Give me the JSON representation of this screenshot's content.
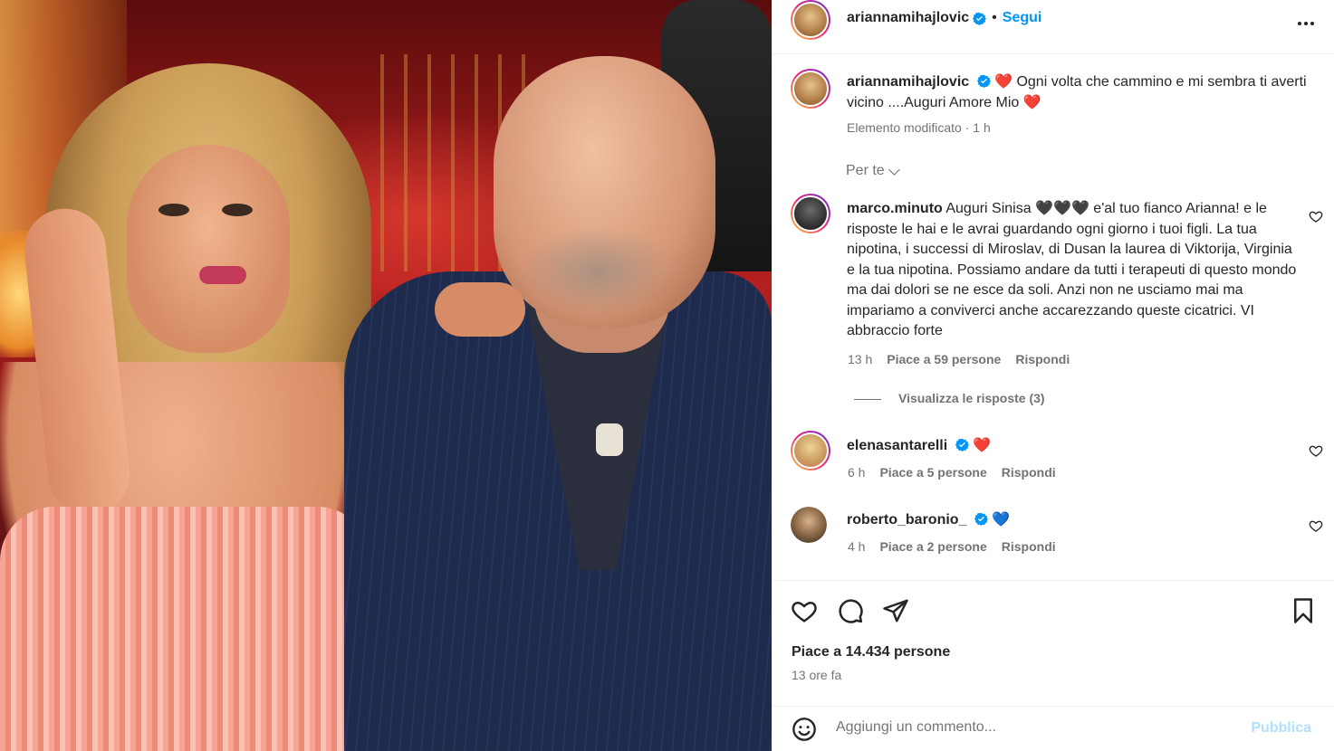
{
  "post": {
    "username": "ariannamihajlovic",
    "follow_label": "Segui",
    "dot": "•",
    "caption_text": "Ogni volta che cammino e mi sembra ti averti vicino ....Auguri Amore Mio",
    "caption_heart_start": "❤️",
    "caption_heart_end": "❤️",
    "caption_meta": "Elemento modificato · 1 h"
  },
  "filter": {
    "label": "Per te"
  },
  "comments": [
    {
      "username": "marco.minuto",
      "text_prefix": "Auguri Sinisa",
      "text_hearts": "🖤🖤🖤",
      "text_rest": " e'al tuo fianco Arianna! e le risposte le hai e le avrai guardando ogni giorno i tuoi figli. La tua nipotina, i successi di Miroslav, di Dusan la laurea di Viktorija, Virginia e la tua nipotina. Possiamo andare da tutti i terapeuti di questo mondo ma dai dolori se ne esce da soli. Anzi non ne usciamo mai ma impariamo a conviverci anche accarezzando queste cicatrici. VI abbraccio forte",
      "time": "13 h",
      "likes": "Piace a 59 persone",
      "reply": "Rispondi",
      "view_replies": "Visualizza le risposte (3)"
    },
    {
      "username": "elenasantarelli",
      "text": "❤️",
      "time": "6 h",
      "likes": "Piace a 5 persone",
      "reply": "Rispondi"
    },
    {
      "username": "roberto_baronio_",
      "text": "💙",
      "time": "4 h",
      "likes": "Piace a 2 persone",
      "reply": "Rispondi"
    }
  ],
  "actions": {
    "likes_count": "Piace a 14.434 persone",
    "posted": "13 ore fa"
  },
  "composer": {
    "placeholder": "Aggiungi un commento...",
    "post_label": "Pubblica"
  },
  "icons": {
    "verified": "verified-badge-icon",
    "more": "more-options-icon",
    "like": "heart-outline-icon",
    "comment": "comment-icon",
    "share": "share-icon",
    "save": "bookmark-icon",
    "emoji": "emoji-icon",
    "chevron": "chevron-down-icon"
  },
  "colors": {
    "accent": "#0095f6",
    "text": "#262626",
    "muted": "#737373",
    "heart_red": "#e8233b",
    "heart_blue": "#1d6fdc"
  }
}
